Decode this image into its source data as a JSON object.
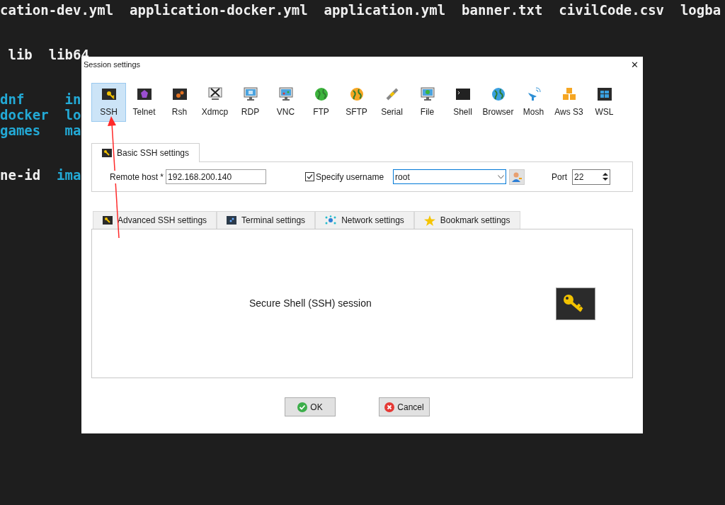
{
  "terminal": {
    "lines": [
      {
        "kind": "plain",
        "segments": [
          {
            "text": "cation-dev.yml",
            "kind": "file"
          },
          {
            "text": "application-docker.yml",
            "kind": "file"
          },
          {
            "text": "application.yml",
            "kind": "file"
          },
          {
            "text": "banner.txt",
            "kind": "file"
          },
          {
            "text": "civilCode.csv",
            "kind": "file"
          },
          {
            "text": "logba",
            "kind": "file"
          }
        ]
      },
      {
        "kind": "indented",
        "segments": [
          {
            "text": "lib",
            "kind": "file"
          },
          {
            "text": "lib64",
            "kind": "file"
          }
        ]
      },
      {
        "kind": "columns",
        "segments": [
          {
            "text": "dnf",
            "kind": "dir"
          },
          {
            "text": "in",
            "kind": "dir"
          }
        ]
      },
      {
        "kind": "columns",
        "segments": [
          {
            "text": "docker",
            "kind": "dir"
          },
          {
            "text": "lo",
            "kind": "dir"
          }
        ]
      },
      {
        "kind": "columns",
        "segments": [
          {
            "text": "games",
            "kind": "dir"
          },
          {
            "text": "ma",
            "kind": "dir"
          }
        ]
      },
      {
        "kind": "plain",
        "segments": [
          {
            "text": "ne-id",
            "kind": "file"
          },
          {
            "text": "ima",
            "kind": "dir"
          }
        ]
      }
    ]
  },
  "dialog": {
    "title": "Session settings",
    "close": "✕",
    "session_types": [
      {
        "label": "SSH",
        "selected": true
      },
      {
        "label": "Telnet",
        "selected": false
      },
      {
        "label": "Rsh",
        "selected": false
      },
      {
        "label": "Xdmcp",
        "selected": false
      },
      {
        "label": "RDP",
        "selected": false
      },
      {
        "label": "VNC",
        "selected": false
      },
      {
        "label": "FTP",
        "selected": false
      },
      {
        "label": "SFTP",
        "selected": false
      },
      {
        "label": "Serial",
        "selected": false
      },
      {
        "label": "File",
        "selected": false
      },
      {
        "label": "Shell",
        "selected": false
      },
      {
        "label": "Browser",
        "selected": false
      },
      {
        "label": "Mosh",
        "selected": false
      },
      {
        "label": "Aws S3",
        "selected": false
      },
      {
        "label": "WSL",
        "selected": false
      }
    ],
    "basic_tab": {
      "label": "Basic SSH settings",
      "selected": true
    },
    "remote_host": {
      "label": "Remote host *",
      "value": "192.168.200.140"
    },
    "specify_username": {
      "label": "Specify username",
      "checked": true,
      "value": "root"
    },
    "port": {
      "label": "Port",
      "value": "22"
    },
    "settings_tabs": [
      {
        "label": "Advanced SSH settings",
        "selected": false
      },
      {
        "label": "Terminal settings",
        "selected": false
      },
      {
        "label": "Network settings",
        "selected": false
      },
      {
        "label": "Bookmark settings",
        "selected": false
      }
    ],
    "description": "Secure Shell (SSH) session",
    "buttons": [
      {
        "label": "OK",
        "kind": "ok"
      },
      {
        "label": "Cancel",
        "kind": "cancel"
      }
    ]
  }
}
